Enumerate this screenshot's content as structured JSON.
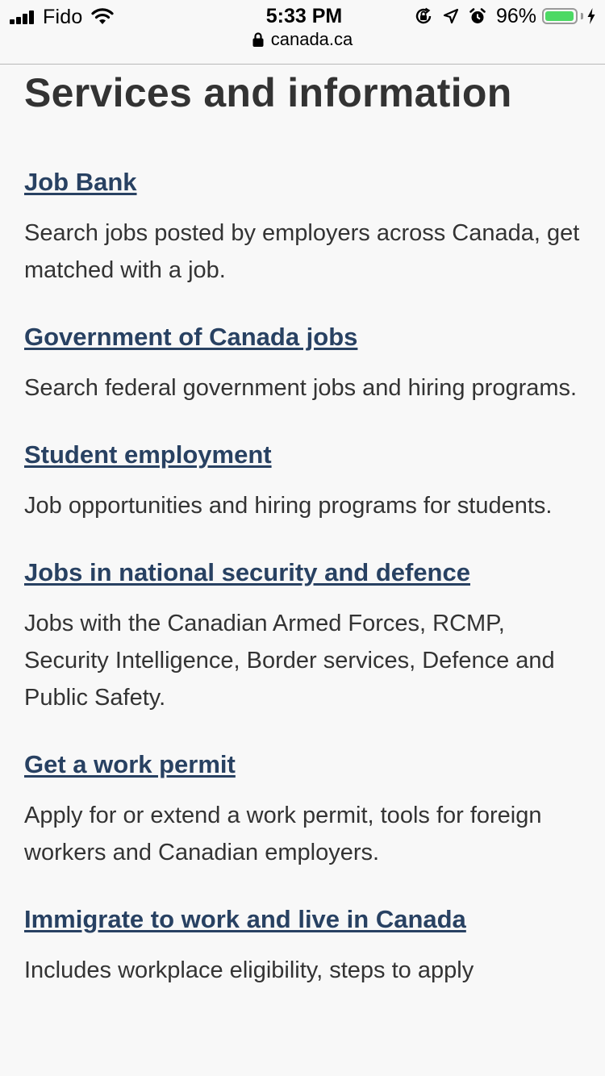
{
  "status_bar": {
    "carrier": "Fido",
    "time": "5:33 PM",
    "battery_percent": "96%",
    "battery_level": 0.96,
    "icons": [
      "signal-icon",
      "wifi-icon",
      "orientation-lock-icon",
      "location-icon",
      "alarm-icon",
      "battery-icon",
      "charging-icon"
    ]
  },
  "browser": {
    "url": "canada.ca"
  },
  "main": {
    "title": "Services and information",
    "services": [
      {
        "link": "Job Bank",
        "description": "Search jobs posted by employers across Canada, get matched with a job."
      },
      {
        "link": "Government of Canada jobs",
        "description": "Search federal government jobs and hiring programs."
      },
      {
        "link": "Student employment",
        "description": "Job opportunities and hiring programs for students."
      },
      {
        "link": "Jobs in national security and defence",
        "description": "Jobs with the Canadian Armed Forces, RCMP, Security Intelligence, Border services, Defence and Public Safety."
      },
      {
        "link": "Get a work permit",
        "description": "Apply for or extend a work permit, tools for foreign workers and Canadian employers."
      },
      {
        "link": "Immigrate to work and live in Canada",
        "description": "Includes workplace eligibility, steps to apply"
      }
    ]
  },
  "colors": {
    "link": "#284162",
    "text": "#333333",
    "background": "#f8f8f8",
    "battery_fill": "#4cd964"
  }
}
